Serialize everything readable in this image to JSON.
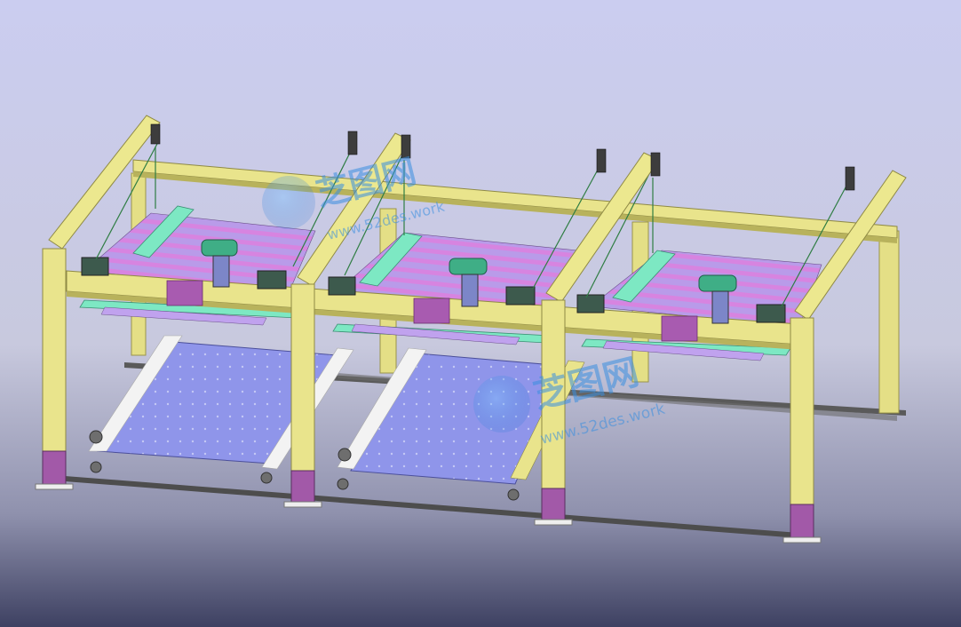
{
  "scene": {
    "colors": {
      "bg_top": "#c9cbee",
      "bg_mid": "#c7c8dc",
      "bg_bottom": "#3f4263",
      "column": "#e9e48c",
      "column_dark": "#b9b35a",
      "base_purple": "#a259a8",
      "deck_pink": "#d07ad8",
      "deck_lilac": "#b89ae8",
      "teal": "#7de8c3",
      "pallet": "#8f95ea",
      "motor_green": "#3fae86",
      "rail": "#5a5a5a",
      "watermark": "#3a8fe0"
    }
  },
  "watermark": {
    "logo_text": "芝图网",
    "url_text": "www.52des.work"
  }
}
